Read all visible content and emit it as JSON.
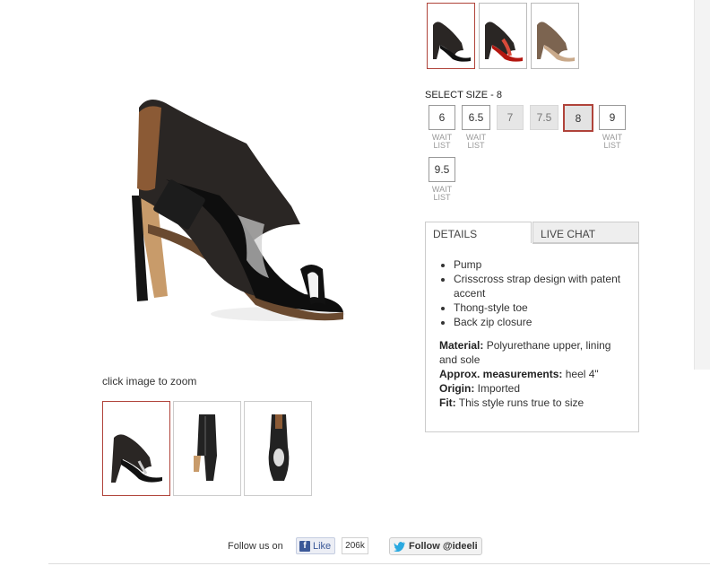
{
  "zoom_hint": "click image to zoom",
  "size_selector": {
    "title": "SELECT SIZE - 8",
    "sizes": [
      {
        "label": "6",
        "state": "available",
        "note": "WAIT LIST"
      },
      {
        "label": "6.5",
        "state": "available",
        "note": "WAIT LIST"
      },
      {
        "label": "7",
        "state": "disabled",
        "note": ""
      },
      {
        "label": "7.5",
        "state": "disabled",
        "note": ""
      },
      {
        "label": "8",
        "state": "selected",
        "note": ""
      },
      {
        "label": "9",
        "state": "available",
        "note": "WAIT LIST"
      },
      {
        "label": "9.5",
        "state": "available",
        "note": "WAIT LIST"
      }
    ],
    "wait_line1": "WAIT",
    "wait_line2": "LIST"
  },
  "tabs": {
    "details": "DETAILS",
    "live_chat": "LIVE CHAT"
  },
  "details": {
    "bullets": [
      "Pump",
      "Crisscross strap design with patent accent",
      "Thong-style toe",
      "Back zip closure"
    ],
    "material_label": "Material:",
    "material_value": "Polyurethane upper, lining and sole",
    "measurements_label": "Approx. measurements:",
    "measurements_value": "heel 4\"",
    "origin_label": "Origin:",
    "origin_value": "Imported",
    "fit_label": "Fit:",
    "fit_value": "This style runs true to size"
  },
  "colors": {
    "accent": "#b0433a",
    "swatches": [
      "black",
      "red",
      "taupe"
    ]
  },
  "footer": {
    "follow_label": "Follow us on",
    "fb_like": "Like",
    "fb_count": "206k",
    "twitter_follow": "Follow @ideeli"
  }
}
